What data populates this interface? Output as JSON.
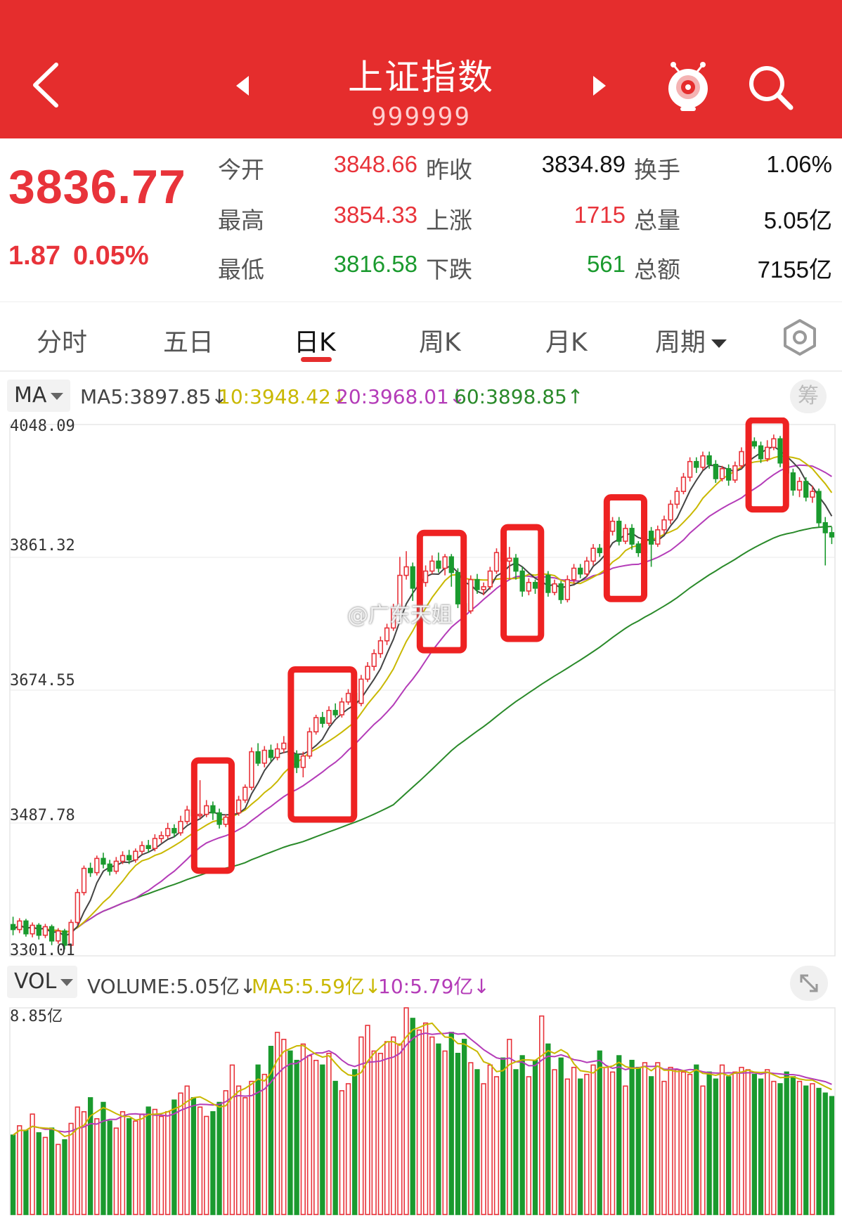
{
  "header": {
    "title": "上证指数",
    "code": "999999"
  },
  "quote": {
    "price": "3836.77",
    "change": "1.87",
    "change_pct": "0.05%",
    "rows": [
      [
        {
          "label": "今开",
          "value": "3848.66",
          "color": "red"
        },
        {
          "label": "昨收",
          "value": "3834.89",
          "color": "dark"
        },
        {
          "label": "换手",
          "value": "1.06%",
          "color": "dark"
        }
      ],
      [
        {
          "label": "最高",
          "value": "3854.33",
          "color": "red"
        },
        {
          "label": "上涨",
          "value": "1715",
          "color": "red"
        },
        {
          "label": "总量",
          "value": "5.05亿",
          "color": "dark"
        }
      ],
      [
        {
          "label": "最低",
          "value": "3816.58",
          "color": "green"
        },
        {
          "label": "下跌",
          "value": "561",
          "color": "green"
        },
        {
          "label": "总额",
          "value": "7155亿",
          "color": "dark"
        }
      ]
    ]
  },
  "tabs": [
    "分时",
    "五日",
    "日K",
    "周K",
    "月K",
    "周期"
  ],
  "active_tab": "日K",
  "ma": {
    "button": "MA",
    "items": [
      "MA5:3897.85↓",
      "10:3948.42↓",
      "20:3968.01↓",
      "60:3898.85↑"
    ],
    "chip": "筹"
  },
  "vol": {
    "button": "VOL",
    "items": [
      "VOLUME:5.05亿↓",
      "MA5:5.59亿↓",
      "10:5.79亿↓"
    ],
    "top_label": "8.85亿"
  },
  "watermark": "@广东天姐",
  "colors": {
    "brand": "#e52d2d",
    "up": "#e8333a",
    "down": "#1a9a2e",
    "ma5": "#444444",
    "ma10": "#c9b800",
    "ma20": "#b43cb8",
    "ma60": "#2a8a2a",
    "highlight": "#ee2222"
  },
  "chart_data": {
    "type": "candlestick",
    "y_ticks": [
      "4048.09",
      "3861.32",
      "3674.55",
      "3487.78",
      "3301.01"
    ],
    "ylim": [
      3301.01,
      4048.09
    ],
    "candles": [
      [
        3345,
        3338,
        3356,
        3330
      ],
      [
        3338,
        3350,
        3354,
        3333
      ],
      [
        3350,
        3332,
        3353,
        3328
      ],
      [
        3332,
        3344,
        3348,
        3327
      ],
      [
        3344,
        3330,
        3347,
        3324
      ],
      [
        3330,
        3342,
        3346,
        3326
      ],
      [
        3342,
        3322,
        3345,
        3316
      ],
      [
        3322,
        3336,
        3340,
        3318
      ],
      [
        3336,
        3316,
        3339,
        3310
      ],
      [
        3316,
        3348,
        3352,
        3310
      ],
      [
        3348,
        3390,
        3395,
        3344
      ],
      [
        3390,
        3424,
        3428,
        3386
      ],
      [
        3424,
        3418,
        3432,
        3412
      ],
      [
        3418,
        3438,
        3442,
        3414
      ],
      [
        3438,
        3430,
        3446,
        3424
      ],
      [
        3430,
        3420,
        3436,
        3414
      ],
      [
        3420,
        3434,
        3440,
        3416
      ],
      [
        3434,
        3442,
        3448,
        3430
      ],
      [
        3442,
        3436,
        3450,
        3430
      ],
      [
        3436,
        3448,
        3452,
        3432
      ],
      [
        3448,
        3456,
        3462,
        3444
      ],
      [
        3456,
        3452,
        3464,
        3446
      ],
      [
        3452,
        3466,
        3472,
        3448
      ],
      [
        3466,
        3470,
        3476,
        3460
      ],
      [
        3470,
        3480,
        3488,
        3466
      ],
      [
        3480,
        3474,
        3486,
        3468
      ],
      [
        3474,
        3490,
        3498,
        3470
      ],
      [
        3490,
        3506,
        3512,
        3486
      ],
      [
        3506,
        3498,
        3514,
        3490
      ],
      [
        3498,
        3500,
        3548,
        3494
      ],
      [
        3500,
        3512,
        3520,
        3496
      ],
      [
        3512,
        3502,
        3518,
        3492
      ],
      [
        3502,
        3486,
        3508,
        3480
      ],
      [
        3486,
        3496,
        3500,
        3482
      ],
      [
        3496,
        3502,
        3508,
        3490
      ],
      [
        3502,
        3520,
        3526,
        3498
      ],
      [
        3520,
        3538,
        3542,
        3516
      ],
      [
        3538,
        3588,
        3594,
        3534
      ],
      [
        3588,
        3572,
        3600,
        3568
      ],
      [
        3572,
        3590,
        3596,
        3566
      ],
      [
        3590,
        3580,
        3598,
        3574
      ],
      [
        3580,
        3592,
        3600,
        3576
      ],
      [
        3592,
        3600,
        3610,
        3586
      ],
      [
        3600,
        3584,
        3606,
        3578
      ],
      [
        3584,
        3566,
        3590,
        3558
      ],
      [
        3566,
        3582,
        3588,
        3552
      ],
      [
        3582,
        3616,
        3622,
        3578
      ],
      [
        3616,
        3636,
        3640,
        3612
      ],
      [
        3636,
        3628,
        3644,
        3622
      ],
      [
        3628,
        3646,
        3652,
        3624
      ],
      [
        3646,
        3640,
        3656,
        3636
      ],
      [
        3640,
        3658,
        3664,
        3636
      ],
      [
        3658,
        3670,
        3676,
        3654
      ],
      [
        3670,
        3656,
        3678,
        3650
      ],
      [
        3656,
        3690,
        3696,
        3652
      ],
      [
        3690,
        3708,
        3714,
        3686
      ],
      [
        3708,
        3726,
        3732,
        3702
      ],
      [
        3726,
        3744,
        3750,
        3720
      ],
      [
        3744,
        3762,
        3768,
        3738
      ],
      [
        3762,
        3790,
        3796,
        3758
      ],
      [
        3790,
        3836,
        3862,
        3786
      ],
      [
        3836,
        3848,
        3870,
        3830
      ],
      [
        3848,
        3818,
        3854,
        3800
      ],
      [
        3818,
        3826,
        3840,
        3812
      ],
      [
        3826,
        3842,
        3850,
        3820
      ],
      [
        3842,
        3856,
        3864,
        3838
      ],
      [
        3856,
        3846,
        3868,
        3840
      ],
      [
        3846,
        3862,
        3866,
        3836
      ],
      [
        3862,
        3840,
        3866,
        3820
      ],
      [
        3840,
        3796,
        3846,
        3790
      ],
      [
        3796,
        3786,
        3802,
        3778
      ],
      [
        3786,
        3830,
        3836,
        3782
      ],
      [
        3830,
        3816,
        3838,
        3810
      ],
      [
        3816,
        3820,
        3826,
        3808
      ],
      [
        3820,
        3842,
        3848,
        3816
      ],
      [
        3842,
        3868,
        3874,
        3838
      ],
      [
        3868,
        3856,
        3878,
        3850
      ],
      [
        3856,
        3860,
        3876,
        3830
      ],
      [
        3860,
        3842,
        3866,
        3830
      ],
      [
        3842,
        3814,
        3848,
        3806
      ],
      [
        3814,
        3826,
        3832,
        3808
      ],
      [
        3826,
        3818,
        3830,
        3810
      ],
      [
        3818,
        3836,
        3842,
        3812
      ],
      [
        3836,
        3812,
        3842,
        3806
      ],
      [
        3812,
        3824,
        3830,
        3808
      ],
      [
        3824,
        3802,
        3828,
        3796
      ],
      [
        3802,
        3830,
        3836,
        3798
      ],
      [
        3830,
        3846,
        3852,
        3824
      ],
      [
        3846,
        3838,
        3852,
        3832
      ],
      [
        3838,
        3856,
        3862,
        3834
      ],
      [
        3856,
        3874,
        3880,
        3850
      ],
      [
        3874,
        3868,
        3880,
        3862
      ],
      [
        3868,
        3898,
        3904,
        3864
      ],
      [
        3898,
        3912,
        3918,
        3892
      ],
      [
        3912,
        3884,
        3918,
        3878
      ],
      [
        3884,
        3902,
        3908,
        3880
      ],
      [
        3902,
        3880,
        3908,
        3872
      ],
      [
        3880,
        3868,
        3884,
        3862
      ],
      [
        3868,
        3898,
        3902,
        3862
      ],
      [
        3898,
        3880,
        3904,
        3848
      ],
      [
        3880,
        3900,
        3906,
        3876
      ],
      [
        3900,
        3914,
        3920,
        3894
      ],
      [
        3914,
        3936,
        3942,
        3908
      ],
      [
        3936,
        3954,
        3960,
        3930
      ],
      [
        3954,
        3974,
        3980,
        3950
      ],
      [
        3974,
        3996,
        4002,
        3968
      ],
      [
        3996,
        3988,
        4002,
        3980
      ],
      [
        3988,
        4004,
        4010,
        3984
      ],
      [
        4004,
        3992,
        4010,
        3986
      ],
      [
        3992,
        3972,
        3998,
        3966
      ],
      [
        3972,
        3986,
        3990,
        3968
      ],
      [
        3986,
        3970,
        3992,
        3962
      ],
      [
        3970,
        3990,
        3996,
        3966
      ],
      [
        3990,
        4010,
        4016,
        3986
      ],
      [
        4010,
        4024,
        4032,
        4004
      ],
      [
        4024,
        4018,
        4030,
        4014
      ],
      [
        4018,
        4000,
        4024,
        3994
      ],
      [
        4000,
        4016,
        4026,
        3996
      ],
      [
        4016,
        4028,
        4034,
        4012
      ],
      [
        4028,
        3994,
        4032,
        3988
      ],
      [
        3994,
        3980,
        3998,
        3972
      ],
      [
        3980,
        3956,
        3986,
        3948
      ],
      [
        3956,
        3968,
        3974,
        3946
      ],
      [
        3968,
        3946,
        3974,
        3940
      ],
      [
        3946,
        3954,
        3962,
        3938
      ],
      [
        3954,
        3910,
        3958,
        3904
      ],
      [
        3910,
        3896,
        3918,
        3850
      ],
      [
        3896,
        3890,
        3904,
        3880
      ]
    ],
    "boxes": [
      {
        "from": 29,
        "to": 33
      },
      {
        "from": 44,
        "to": 52
      },
      {
        "from": 64,
        "to": 69
      },
      {
        "from": 77,
        "to": 81
      },
      {
        "from": 93,
        "to": 97
      },
      {
        "from": 115,
        "to": 119
      }
    ],
    "volumes": [
      3.4,
      3.8,
      3.6,
      4.3,
      3.5,
      3.3,
      3.7,
      3.0,
      3.2,
      3.9,
      4.6,
      4.4,
      5.0,
      4.1,
      4.8,
      4.0,
      3.7,
      4.4,
      4.1,
      4.0,
      4.3,
      4.6,
      4.5,
      4.2,
      4.4,
      4.9,
      5.2,
      5.5,
      5.0,
      4.6,
      4.2,
      4.4,
      4.8,
      5.3,
      6.4,
      5.5,
      5.0,
      5.7,
      6.4,
      6.0,
      7.2,
      7.8,
      7.5,
      7.0,
      6.6,
      7.3,
      6.8,
      6.6,
      6.4,
      6.9,
      5.7,
      5.3,
      5.6,
      6.2,
      7.6,
      8.1,
      7.0,
      6.9,
      7.4,
      7.6,
      7.3,
      8.85,
      8.4,
      7.9,
      8.2,
      7.6,
      7.3,
      7.0,
      7.8,
      6.9,
      7.5,
      6.5,
      6.2,
      5.6,
      6.4,
      5.9,
      6.7,
      7.5,
      6.2,
      6.8,
      5.9,
      6.6,
      8.5,
      7.3,
      6.2,
      6.7,
      5.8,
      6.3,
      5.8,
      6.0,
      6.4,
      7.0,
      6.3,
      6.1,
      6.8,
      5.5,
      6.6,
      6.3,
      6.5,
      5.9,
      6.5,
      5.7,
      6.3,
      6.2,
      6.1,
      6.0,
      6.4,
      5.5,
      6.1,
      5.8,
      6.4,
      5.9,
      6.1,
      6.3,
      6.2,
      6.0,
      5.8,
      6.2,
      5.7,
      5.6,
      6.1,
      5.9,
      5.7,
      5.5,
      5.6,
      5.4,
      5.2,
      5.05
    ]
  }
}
